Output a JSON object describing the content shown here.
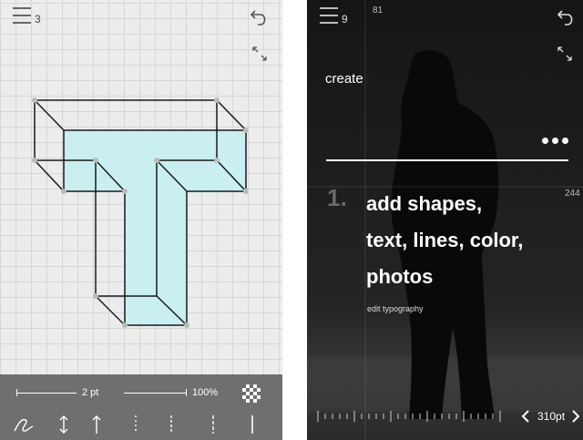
{
  "left_screen": {
    "menu_count": "3",
    "toolbar": {
      "stroke_label": "2 pt",
      "opacity_label": "100%",
      "bottom_tools": [
        {
          "icon": "freehand-curve-icon"
        },
        {
          "icon": "vertical-double-arrow-icon"
        },
        {
          "icon": "up-arrow-icon"
        },
        {
          "icon": "dotted-line-icon"
        },
        {
          "icon": "dotted-line-icon"
        },
        {
          "icon": "dotted-line-icon"
        },
        {
          "icon": "solid-line-icon"
        }
      ]
    }
  },
  "right_screen": {
    "menu_count": "9",
    "ruler_top_value": "81",
    "ruler_side_value": "244",
    "section_label": "create",
    "step_number": "1.",
    "headline": [
      "add shapes,",
      "text, lines, color,",
      "photos"
    ],
    "subtext": "edit typography",
    "size_value": "310pt"
  },
  "colors": {
    "shape_fill": "#c9eff0",
    "toolbar_bg": "#6f6f6f",
    "dark_bg": "#1a1a1a"
  }
}
